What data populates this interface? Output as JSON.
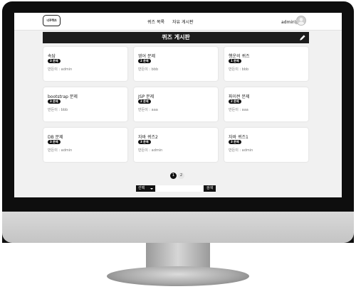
{
  "nav": {
    "logo_text": "너꾸퀴즈",
    "links": [
      "퀴즈 목록",
      "자유 게시판"
    ],
    "user": "admin님"
  },
  "board": {
    "title": "퀴즈 게시판"
  },
  "cards": [
    {
      "title": "속담",
      "badge": "3 문제",
      "author": "만든이 : admin"
    },
    {
      "title": "영어 문제",
      "badge": "2 문제",
      "author": "만든이 : bbb"
    },
    {
      "title": "행운의 퀴즈",
      "badge": "1 문제",
      "author": "만든이 : bbb"
    },
    {
      "title": "bootstrap 문제",
      "badge": "3 문제",
      "author": "만든이 : bbb"
    },
    {
      "title": "JSP 문제",
      "badge": "2 문제",
      "author": "만든이 : aaa"
    },
    {
      "title": "파이썬 문제",
      "badge": "2 문제",
      "author": "만든이 : aaa"
    },
    {
      "title": "DB 문제",
      "badge": "3 문제",
      "author": "만든이 : admin"
    },
    {
      "title": "자바 퀴즈2",
      "badge": "3 문제",
      "author": "만든이 : admin"
    },
    {
      "title": "자바 퀴즈1",
      "badge": "3 문제",
      "author": "만든이 : admin"
    }
  ],
  "pagination": {
    "pages": [
      "1",
      "2"
    ],
    "current": "1"
  },
  "search": {
    "select_label": "선택",
    "input_value": "",
    "button_label": "검색"
  },
  "colors": {
    "accent": "#1c1c1c",
    "background": "#f1f1f1",
    "card": "#ffffff"
  }
}
